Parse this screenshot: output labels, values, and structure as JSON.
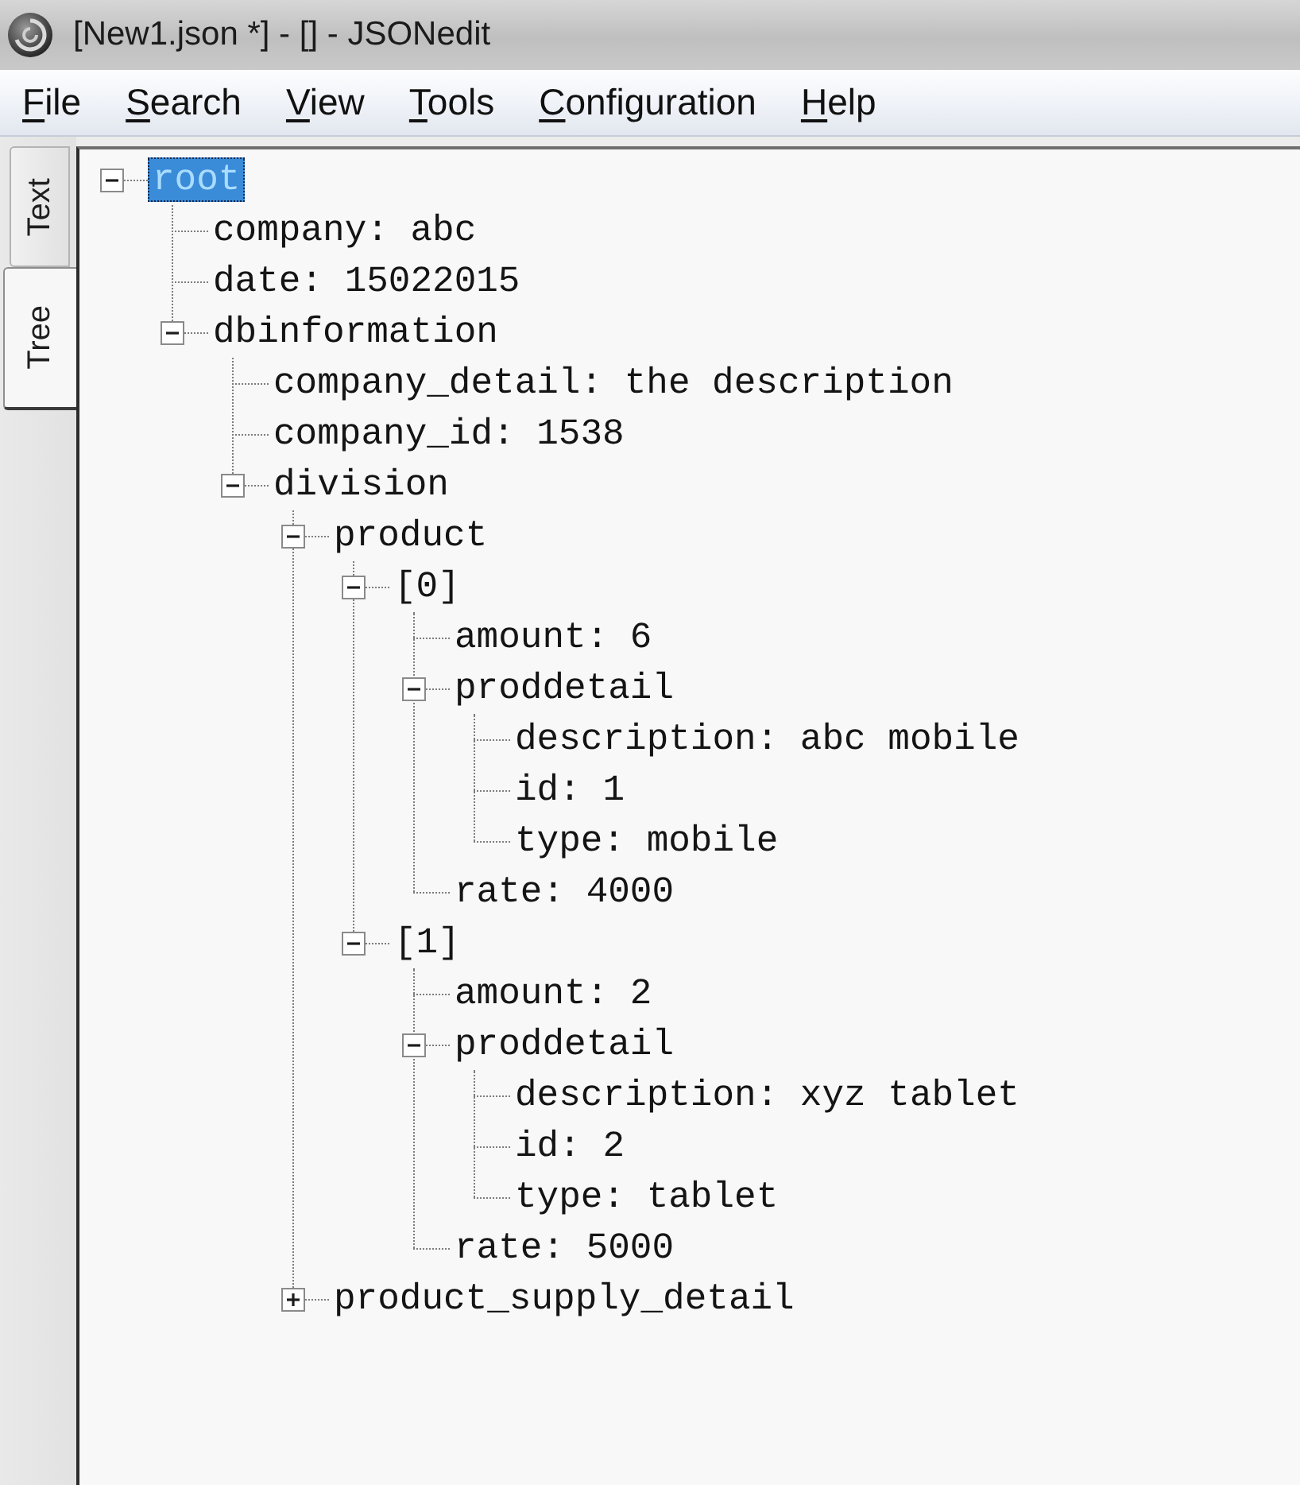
{
  "window": {
    "title": "[New1.json *] - [] - JSONedit"
  },
  "menu": [
    "File",
    "Search",
    "View",
    "Tools",
    "Configuration",
    "Help"
  ],
  "side_tabs": [
    {
      "label": "Text",
      "selected": false
    },
    {
      "label": "Tree",
      "selected": true
    }
  ],
  "tree": {
    "label": "root",
    "selected": true,
    "expanded": true,
    "children": [
      {
        "label": "company: abc",
        "selected": false
      },
      {
        "label": "date: 15022015",
        "selected": false
      },
      {
        "label": "dbinformation",
        "selected": false,
        "expanded": true,
        "children": [
          {
            "label": "company_detail: the description",
            "selected": false
          },
          {
            "label": "company_id: 1538",
            "selected": false
          },
          {
            "label": "division",
            "selected": false,
            "expanded": true,
            "children": [
              {
                "label": "product",
                "selected": false,
                "expanded": true,
                "children": [
                  {
                    "label": "[0]",
                    "selected": false,
                    "expanded": true,
                    "children": [
                      {
                        "label": "amount: 6",
                        "selected": false
                      },
                      {
                        "label": "proddetail",
                        "selected": false,
                        "expanded": true,
                        "children": [
                          {
                            "label": "description: abc mobile",
                            "selected": false
                          },
                          {
                            "label": "id: 1",
                            "selected": false
                          },
                          {
                            "label": "type: mobile",
                            "selected": false
                          }
                        ]
                      },
                      {
                        "label": "rate: 4000",
                        "selected": false
                      }
                    ]
                  },
                  {
                    "label": "[1]",
                    "selected": false,
                    "expanded": true,
                    "children": [
                      {
                        "label": "amount: 2",
                        "selected": false
                      },
                      {
                        "label": "proddetail",
                        "selected": false,
                        "expanded": true,
                        "children": [
                          {
                            "label": "description: xyz tablet",
                            "selected": false
                          },
                          {
                            "label": "id: 2",
                            "selected": false
                          },
                          {
                            "label": "type: tablet",
                            "selected": false
                          }
                        ]
                      },
                      {
                        "label": "rate: 5000",
                        "selected": false
                      }
                    ]
                  }
                ]
              },
              {
                "label": "product_supply_detail",
                "selected": false,
                "expanded": false
              }
            ]
          }
        ]
      }
    ]
  }
}
